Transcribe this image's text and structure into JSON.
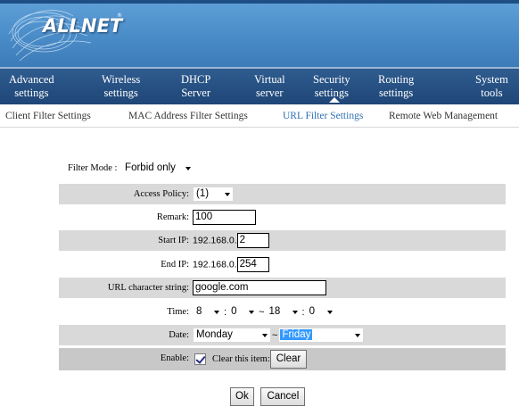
{
  "brand": {
    "logo_text": "ALLNET",
    "trademark": "®"
  },
  "main_nav": [
    {
      "line1": "Advanced",
      "line2": "settings"
    },
    {
      "line1": "Wireless",
      "line2": "settings"
    },
    {
      "line1": "DHCP",
      "line2": "Server"
    },
    {
      "line1": "Virtual",
      "line2": "server"
    },
    {
      "line1": "Security",
      "line2": "settings"
    },
    {
      "line1": "Routing",
      "line2": "settings"
    },
    {
      "line1": "System",
      "line2": "tools"
    }
  ],
  "sub_nav": [
    {
      "label": "Client Filter Settings"
    },
    {
      "label": "MAC Address Filter Settings"
    },
    {
      "label": "URL Filter Settings"
    },
    {
      "label": "Remote Web Management"
    }
  ],
  "form": {
    "filter_mode": {
      "label": "Filter Mode :",
      "value": "Forbid only"
    },
    "access_policy": {
      "label": "Access Policy:",
      "value": "(1)"
    },
    "remark": {
      "label": "Remark:",
      "value": "100"
    },
    "start_ip": {
      "label": "Start IP:",
      "prefix": "192.168.0.",
      "value": "2"
    },
    "end_ip": {
      "label": "End IP:",
      "prefix": "192.168.0.",
      "value": "254"
    },
    "url_string": {
      "label": "URL character string:",
      "value": "google.com"
    },
    "time": {
      "label": "Time:",
      "start_hour": "8",
      "start_min": "0",
      "end_hour": "18",
      "end_min": "0",
      "colon": ":",
      "tilde": "~"
    },
    "date": {
      "label": "Date:",
      "start_day": "Monday",
      "end_day": "Friday",
      "tilde": "~"
    },
    "enable": {
      "label": "Enable:",
      "checked": true,
      "clear_label": "Clear this item:",
      "clear_button": "Clear"
    }
  },
  "buttons": {
    "ok": "Ok",
    "cancel": "Cancel"
  },
  "colors": {
    "nav_bg": "#1f4677",
    "header_bg": "#4a8cc8",
    "active_sub": "#2f6fb5",
    "row_shade": "#d9d9d9",
    "select_highlight": "#3399ff"
  }
}
